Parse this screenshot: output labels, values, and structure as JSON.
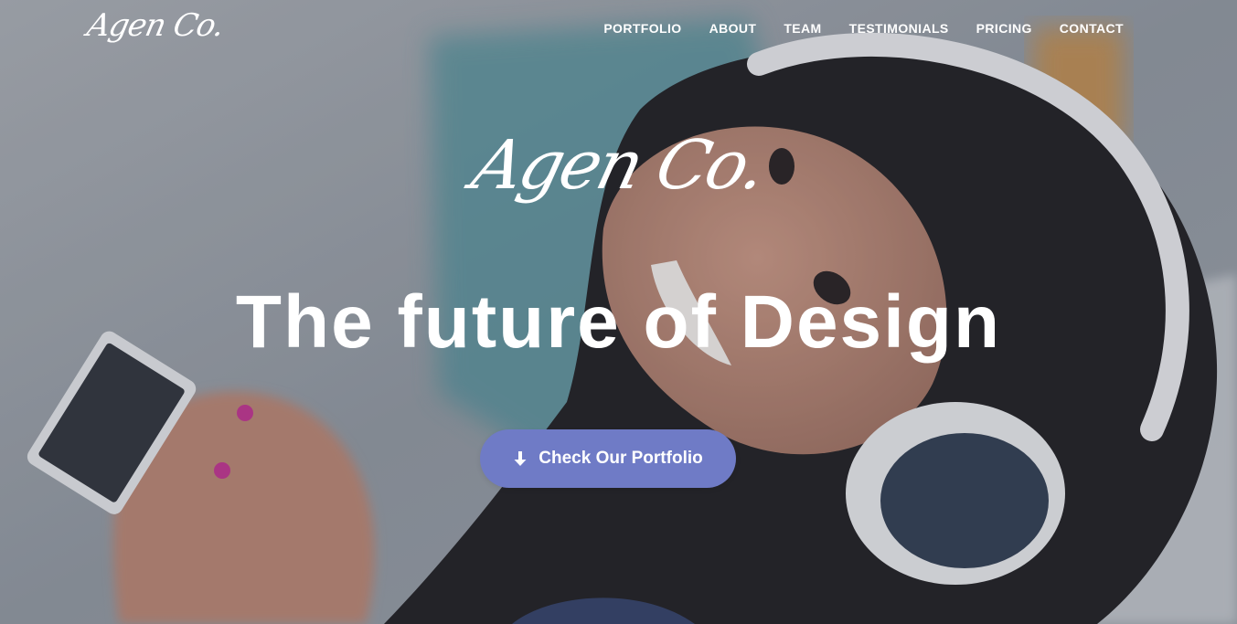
{
  "brand": {
    "name": "Agen Co."
  },
  "nav": {
    "items": [
      {
        "label": "PORTFOLIO"
      },
      {
        "label": "ABOUT"
      },
      {
        "label": "TEAM"
      },
      {
        "label": "TESTIMONIALS"
      },
      {
        "label": "PRICING"
      },
      {
        "label": "CONTACT"
      }
    ]
  },
  "hero": {
    "logo_text": "Agen Co.",
    "headline": "The future of Design",
    "cta_label": "Check Our Portfolio",
    "cta_icon": "arrow-down-icon",
    "background_image": "woman-with-headphones-photo"
  },
  "colors": {
    "button_bg": "#6f7bc6",
    "text": "#ffffff"
  }
}
